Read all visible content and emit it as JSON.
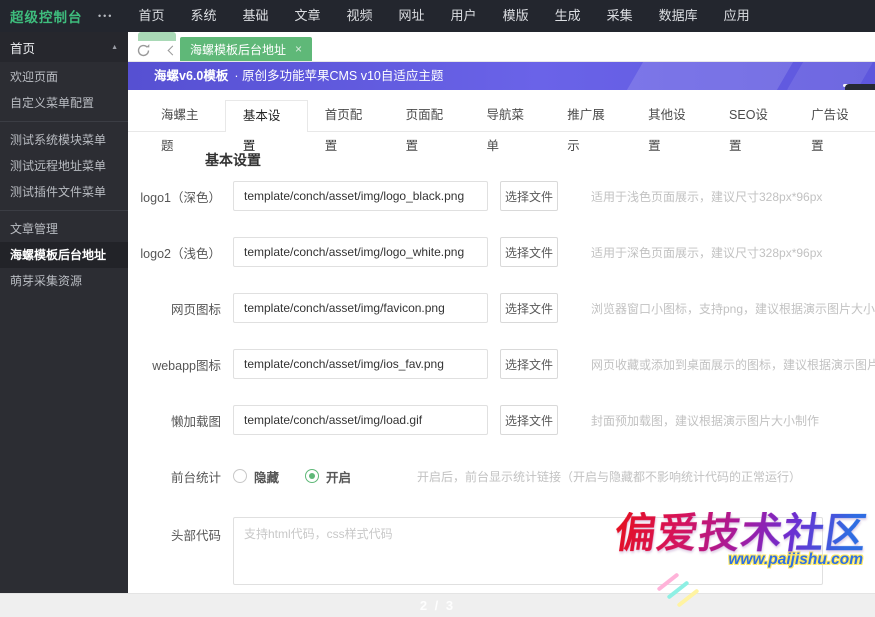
{
  "topbar": {
    "logo": "超级控制台",
    "more_icon": "•••",
    "nav": [
      {
        "label": "首页"
      },
      {
        "label": "系统"
      },
      {
        "label": "基础"
      },
      {
        "label": "文章"
      },
      {
        "label": "视频"
      },
      {
        "label": "网址"
      },
      {
        "label": "用户"
      },
      {
        "label": "模版"
      },
      {
        "label": "生成"
      },
      {
        "label": "采集"
      },
      {
        "label": "数据库"
      },
      {
        "label": "应用"
      }
    ]
  },
  "sidebar": {
    "parent": {
      "label": "首页",
      "expand_icon": "▲"
    },
    "items": [
      {
        "label": "欢迎页面"
      },
      {
        "label": "自定义菜单配置"
      },
      {
        "label": "测试系统模块菜单"
      },
      {
        "label": "测试远程地址菜单"
      },
      {
        "label": "测试插件文件菜单"
      },
      {
        "label": "文章管理"
      },
      {
        "label": "海螺模板后台地址",
        "active": true
      },
      {
        "label": "萌芽采集资源"
      }
    ]
  },
  "tabstrip": {
    "doc_tab": "海螺模板后台地址",
    "close_icon": "×"
  },
  "banner": {
    "title": "海螺v6.0模板",
    "subtitle": "· 原创多功能苹果CMS v10自适应主题"
  },
  "tabs": [
    {
      "label": "海螺主题"
    },
    {
      "label": "基本设置",
      "active": true
    },
    {
      "label": "首页配置"
    },
    {
      "label": "页面配置"
    },
    {
      "label": "导航菜单"
    },
    {
      "label": "推广展示"
    },
    {
      "label": "其他设置"
    },
    {
      "label": "SEO设置"
    },
    {
      "label": "广告设置"
    }
  ],
  "section_title": "基本设置",
  "form": {
    "choose_file": "选择文件",
    "rows": [
      {
        "label": "logo1（深色）",
        "value": "template/conch/asset/img/logo_black.png",
        "hint": "适用于浅色页面展示，建议尺寸328px*96px"
      },
      {
        "label": "logo2（浅色）",
        "value": "template/conch/asset/img/logo_white.png",
        "hint": "适用于深色页面展示，建议尺寸328px*96px"
      },
      {
        "label": "网页图标",
        "value": "template/conch/asset/img/favicon.png",
        "hint": "浏览器窗口小图标，支持png，建议根据演示图片大小制作"
      },
      {
        "label": "webapp图标",
        "value": "template/conch/asset/img/ios_fav.png",
        "hint": "网页收藏或添加到桌面展示的图标，建议根据演示图片大小制作"
      },
      {
        "label": "懒加载图",
        "value": "template/conch/asset/img/load.gif",
        "hint": "封面预加载图，建议根据演示图片大小制作"
      }
    ],
    "stats": {
      "label": "前台统计",
      "options": [
        {
          "label": "隐藏",
          "selected": false
        },
        {
          "label": "开启",
          "selected": true
        }
      ],
      "hint": "开启后，前台显示统计链接（开启与隐藏都不影响统计代码的正常运行）"
    },
    "headcode": {
      "label": "头部代码",
      "placeholder": "支持html代码，css样式代码"
    }
  },
  "footer": {
    "page_indicator": "2 / 3"
  },
  "watermark": {
    "text": "偏爱技术社区",
    "url": "www.paijishu.com"
  },
  "colors": {
    "accent_green": "#5FB878",
    "banner_purple": "#5F58DB",
    "topbar_dark": "#23262e",
    "sidebar_dark": "#2c2d33"
  }
}
